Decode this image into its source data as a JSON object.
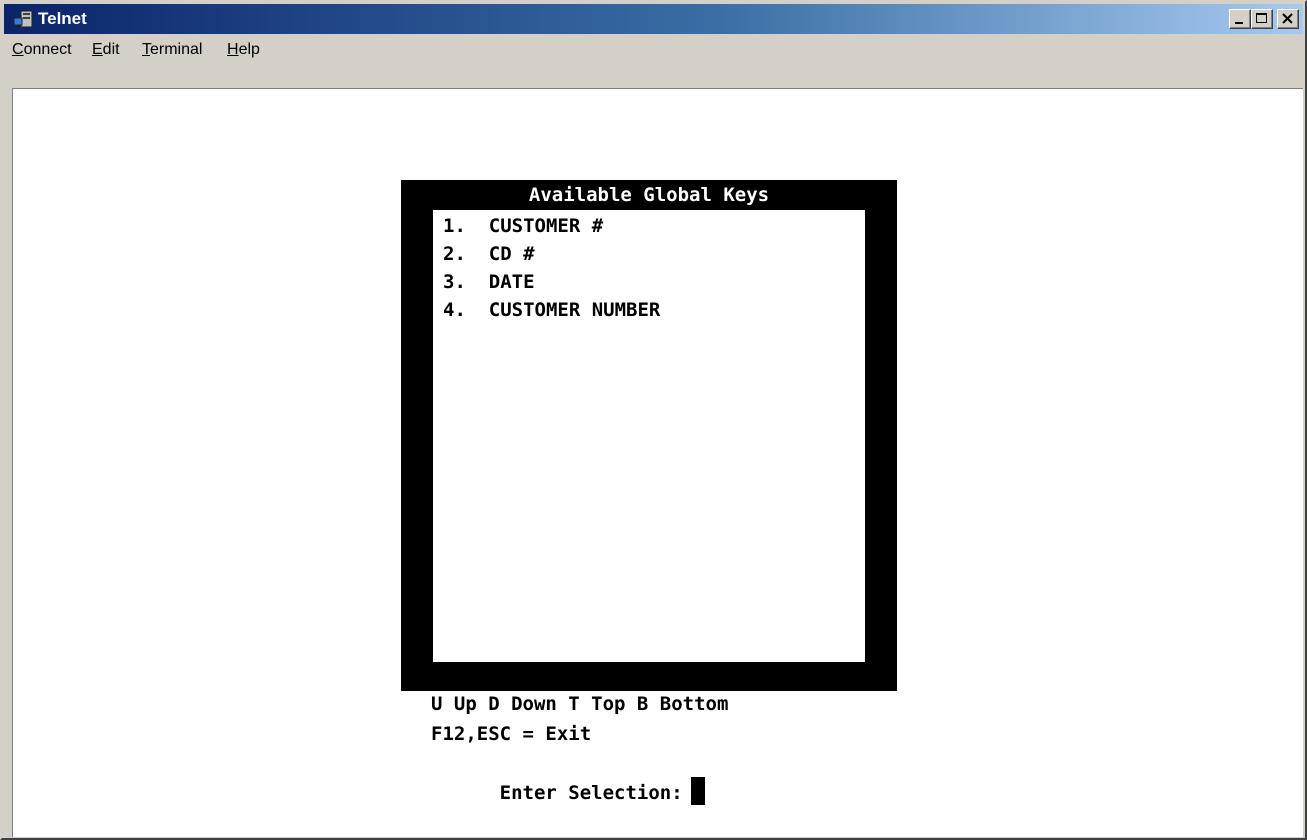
{
  "window": {
    "title": "Telnet",
    "icon": "telnet-icon"
  },
  "menu": {
    "items": [
      "Connect",
      "Edit",
      "Terminal",
      "Help"
    ],
    "accelerators": [
      "C",
      "E",
      "T",
      "H"
    ]
  },
  "dialog": {
    "title": "Available Global Keys",
    "items": [
      "1.  CUSTOMER #",
      "2.  CD #",
      "3.  DATE",
      "4.  CUSTOMER NUMBER"
    ]
  },
  "footer": {
    "nav_hint": "U Up D Down T Top B Bottom",
    "exit_hint": "F12,ESC = Exit",
    "prompt": "Enter Selection:"
  },
  "colors": {
    "titlebar_start": "#0a246a",
    "titlebar_end": "#a6caf0",
    "frame": "#000000",
    "background": "#ffffff"
  }
}
